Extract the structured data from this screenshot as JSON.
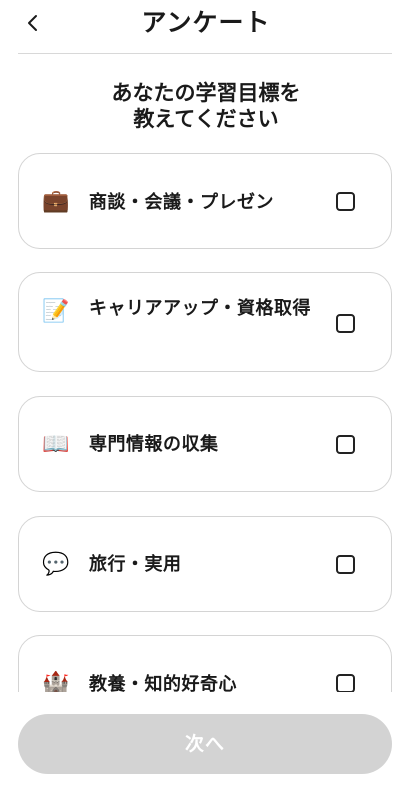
{
  "header": {
    "title": "アンケート",
    "back_icon": "chevron-left-icon"
  },
  "question": {
    "text": "あなたの学習目標を\n教えてください"
  },
  "options": [
    {
      "icon": "💼",
      "icon_name": "briefcase-icon",
      "label": "商談・会議・プレゼン",
      "checked": false
    },
    {
      "icon": "📝",
      "icon_name": "memo-icon",
      "label": "キャリアアップ・資格取得",
      "checked": false
    },
    {
      "icon": "📖",
      "icon_name": "open-book-icon",
      "label": "専門情報の収集",
      "checked": false
    },
    {
      "icon": "💬",
      "icon_name": "speech-bubble-icon",
      "label": "旅行・実用",
      "checked": false
    },
    {
      "icon": "🏰",
      "icon_name": "castle-icon",
      "label": "教養・知的好奇心",
      "checked": false
    }
  ],
  "footer": {
    "next_label": "次へ",
    "next_enabled": false
  },
  "colors": {
    "text": "#1a1a1a",
    "card_border": "#d4d4d4",
    "divider": "#d8d8d8",
    "button_disabled_bg": "#d3d3d3",
    "button_text": "#ffffff"
  }
}
